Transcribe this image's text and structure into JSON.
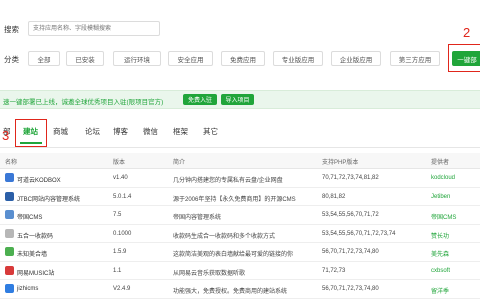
{
  "search": {
    "label": "搜索",
    "placeholder": "支持应用名称、字段模糊搜索"
  },
  "category": {
    "label": "分类",
    "buttons": [
      "全部",
      "已安装",
      "运行环境",
      "安全应用",
      "免费应用",
      "专业版应用",
      "企业版应用",
      "第三方应用"
    ],
    "one_click_label": "一键部"
  },
  "annotations": {
    "n1": "2",
    "n2": "3"
  },
  "banner": {
    "text": "速一键部署已上线，诚邀全球优秀项目入驻(限项目官方)",
    "btn_free": "免费入驻",
    "btn_import": "导入项目"
  },
  "tabs": [
    "部",
    "建站",
    "商城",
    "论坛",
    "博客",
    "微信",
    "框架",
    "其它"
  ],
  "table": {
    "headers": [
      "名称",
      "版本",
      "简介",
      "支持PHP版本",
      "提供者"
    ],
    "rows": [
      {
        "name": "可道云KODBOX",
        "version": "v1.40",
        "desc": "几分钟内搭建您的专属私有云盘/企业网盘",
        "php": "70,71,72,73,74,81,82",
        "provider": "kodcloud",
        "icon_color": "#3a78d6"
      },
      {
        "name": "JTBC网站内容管理系统",
        "version": "5.0.1.4",
        "desc": "源于2006年坚持【永久免费商用】的开源CMS",
        "php": "80,81,82",
        "provider": "Jetiben",
        "icon_color": "#2b5fa8"
      },
      {
        "name": "帝国CMS",
        "version": "7.5",
        "desc": "帝国内容管理系统",
        "php": "53,54,55,56,70,71,72",
        "provider": "帝国CMS",
        "icon_color": "#5a8fd0"
      },
      {
        "name": "五合一收款码",
        "version": "0.1000",
        "desc": "收款码生成合一收款码和多个收款方式",
        "php": "53,54,55,56,70,71,72,73,74",
        "provider": "赞长功",
        "icon_color": "#b7b7b7"
      },
      {
        "name": "未知美合墙",
        "version": "1.5.9",
        "desc": "这款简洁美观的表白墙献给最可爱的链接的你",
        "php": "56,70,71,72,73,74,80",
        "provider": "美先森",
        "icon_color": "#4caf50"
      },
      {
        "name": "网易MUSIC站",
        "version": "1.1",
        "desc": "从网易云音乐获取数据听歌",
        "php": "71,72,73",
        "provider": "cxbsoft",
        "icon_color": "#d83a3a"
      },
      {
        "name": "jizhicms",
        "version": "V2.4.9",
        "desc": "功能强大，免费授权。免费商用的建站系统",
        "php": "56,70,71,72,73,74,80",
        "provider": "留洋季",
        "icon_color": "#2f7de1"
      }
    ]
  }
}
